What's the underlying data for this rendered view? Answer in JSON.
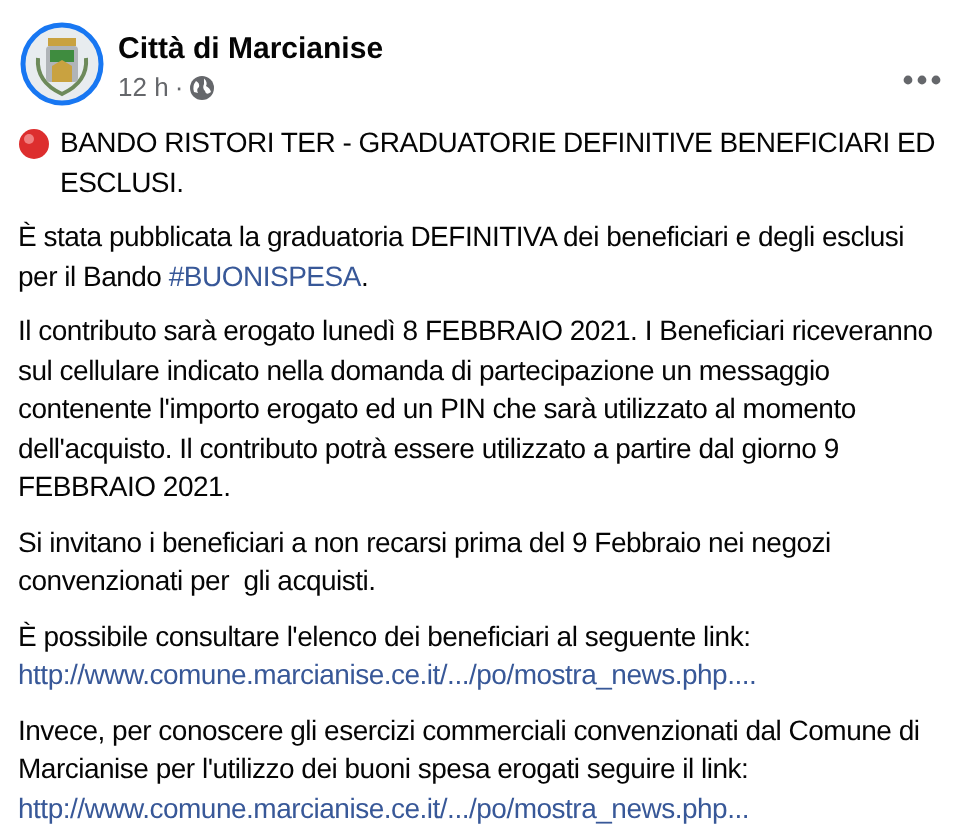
{
  "post": {
    "author": "Città di Marcianise",
    "time": "12 h",
    "separator": "·",
    "title": "BANDO RISTORI TER - GRADUATORIE DEFINITIVE BENEFICIARI ED ESCLUSI.",
    "paragraphs": [
      [
        {
          "kind": "text",
          "text": "È stata pubblicata la graduatoria DEFINITIVA dei beneficiari e degli esclusi  per il Bando "
        },
        {
          "kind": "hashtag",
          "text": "#BUONISPESA"
        },
        {
          "kind": "text",
          "text": "."
        }
      ],
      [
        {
          "kind": "text",
          "text": "Il contributo sarà erogato lunedì 8 FEBBRAIO 2021. I Beneficiari riceveranno sul cellulare indicato nella domanda di partecipazione un messaggio contenente l'importo erogato ed un PIN che sarà utilizzato al momento dell'acquisto. Il contributo potrà essere utilizzato a partire dal giorno 9 FEBBRAIO 2021."
        }
      ],
      [
        {
          "kind": "text",
          "text": "Si invitano i beneficiari a non recarsi prima del 9 Febbraio nei negozi convenzionati per  gli acquisti."
        }
      ],
      [
        {
          "kind": "text",
          "text": "È possibile consultare l'elenco dei beneficiari al seguente link: "
        },
        {
          "kind": "link",
          "text": "http://www.comune.marcianise.ce.it/.../po/mostra_news.php...."
        }
      ],
      [
        {
          "kind": "text",
          "text": "Invece, per conoscere gli esercizi commerciali convenzionati dal Comune di Marcianise per l'utilizzo dei buoni spesa erogati seguire il link: "
        },
        {
          "kind": "link",
          "text": "http://www.comune.marcianise.ce.it/.../po/mostra_news.php..."
        }
      ]
    ]
  }
}
